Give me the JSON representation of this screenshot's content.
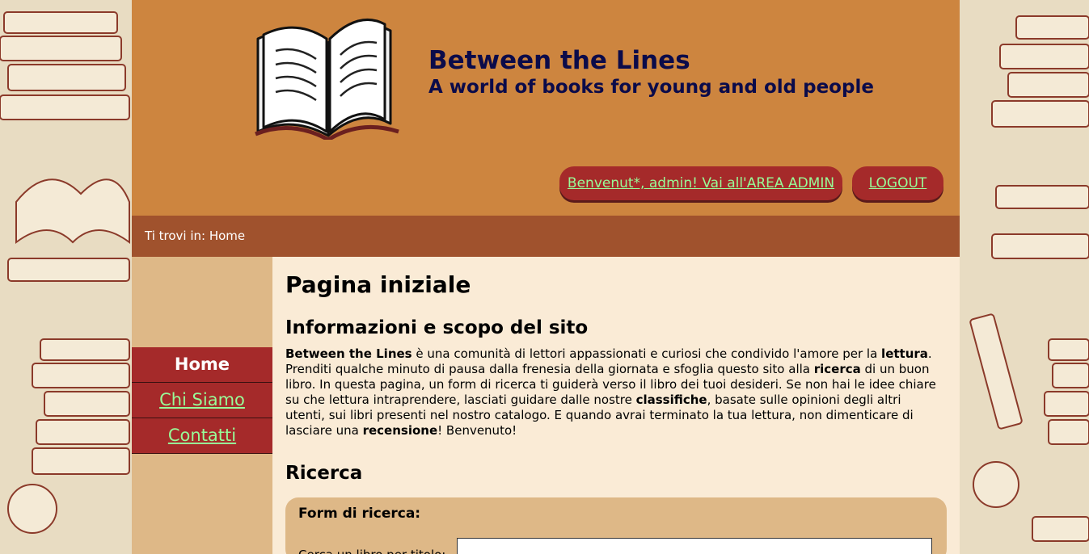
{
  "header": {
    "site_title": "Between the Lines",
    "site_subtitle": "A world of books for young and old people",
    "admin_link": "Benvenut*, admin! Vai all'AREA ADMIN",
    "logout": "LOGOUT"
  },
  "breadcrumb": "Ti trovi in: Home",
  "nav": [
    {
      "label": "Home",
      "current": true
    },
    {
      "label": "Chi Siamo",
      "current": false
    },
    {
      "label": "Contatti",
      "current": false
    }
  ],
  "main": {
    "page_title": "Pagina iniziale",
    "info_title": "Informazioni e scopo del sito",
    "intro": [
      {
        "b": "Between the Lines"
      },
      {
        "t": " è una comunità di lettori appassionati e curiosi che condivido l'amore per la "
      },
      {
        "b": "lettura"
      },
      {
        "t": ". Prenditi qualche minuto di pausa dalla frenesia della giornata e sfoglia questo sito alla "
      },
      {
        "b": "ricerca"
      },
      {
        "t": " di un buon libro. In questa pagina, un form di ricerca ti guiderà verso il libro dei tuoi desideri. Se non hai le idee chiare su che lettura intraprendere, lasciati guidare dalle nostre "
      },
      {
        "b": "classifiche"
      },
      {
        "t": ", basate sulle opinioni degli altri utenti, sui libri presenti nel nostro catalogo. E quando avrai terminato la tua lettura, non dimenticare di lasciare una "
      },
      {
        "b": "recensione"
      },
      {
        "t": "! Benvenuto!"
      }
    ],
    "search_title": "Ricerca",
    "form_title": "Form di ricerca:",
    "form_label": "Cerca un libro per titolo:",
    "input_value": ""
  },
  "colors": {
    "header_bg": "#cd853f",
    "breadcrumb_bg": "#a0522d",
    "button_bg": "#a52a2a",
    "link_color": "#98fb98",
    "title_color": "#0b0b4a",
    "sidebar_bg": "#deb887",
    "content_bg": "#faebd6"
  }
}
